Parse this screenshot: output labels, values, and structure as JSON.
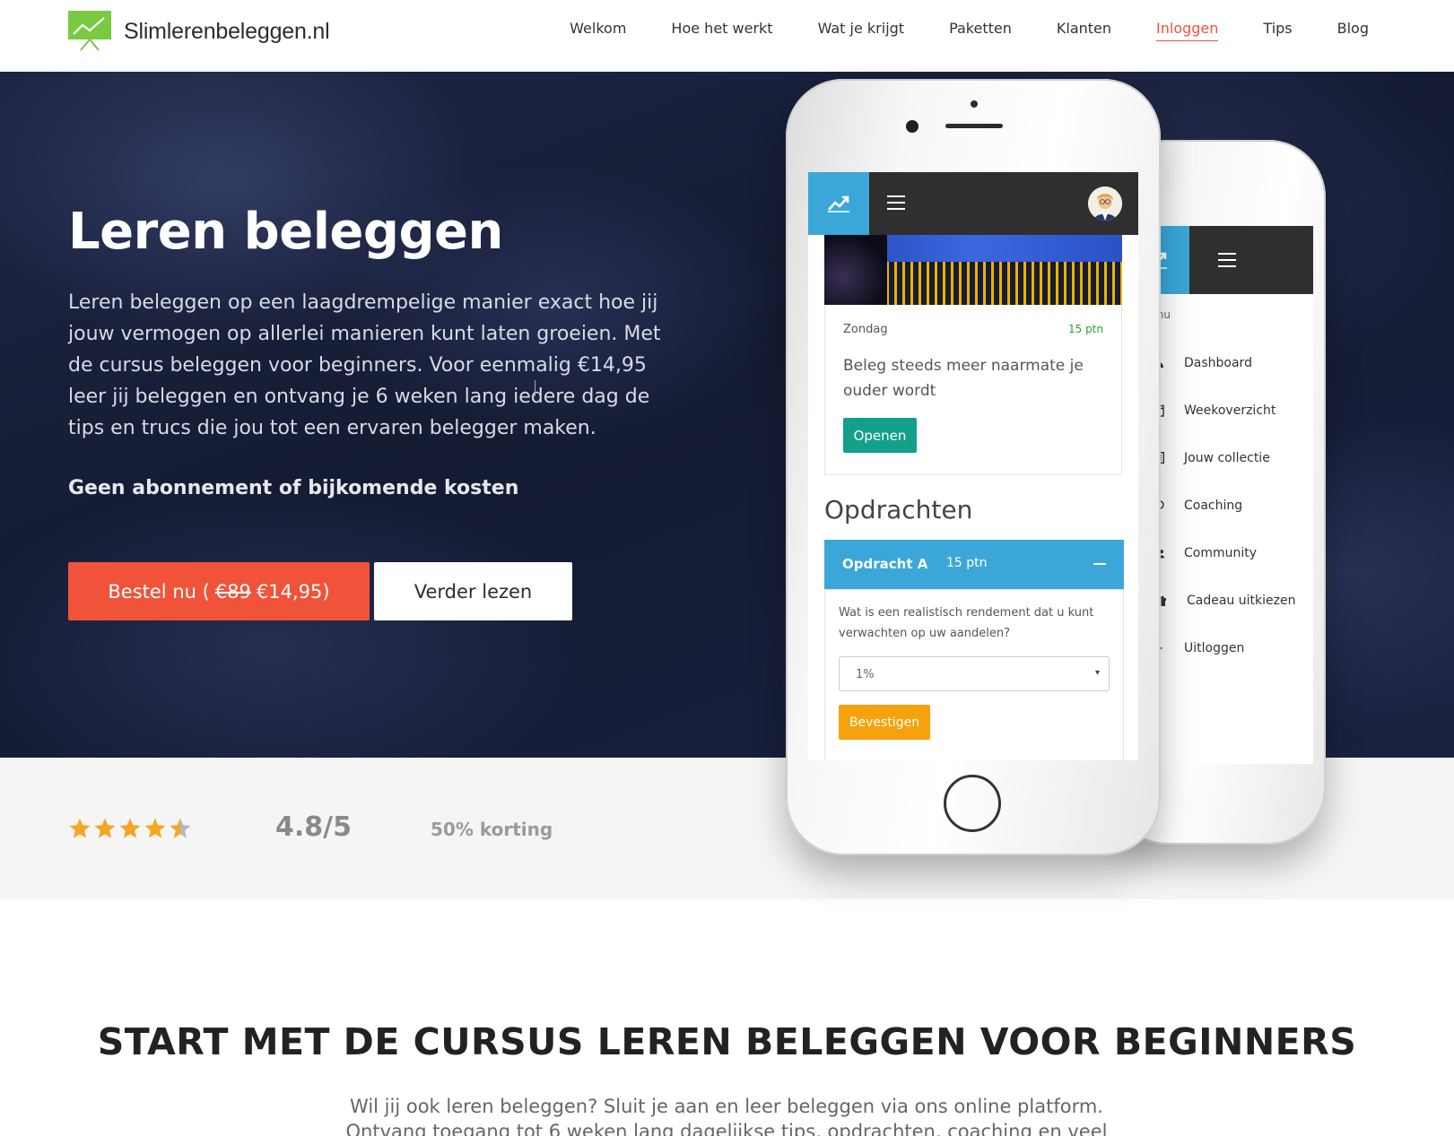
{
  "site": {
    "logo_text": "Slimlerenbeleggen.nl",
    "brand_color": "#7ac943",
    "accent_color": "#f0533a"
  },
  "nav": {
    "items": [
      {
        "label": "Welkom",
        "active": false
      },
      {
        "label": "Hoe het werkt",
        "active": false
      },
      {
        "label": "Wat je krijgt",
        "active": false
      },
      {
        "label": "Paketten",
        "active": false
      },
      {
        "label": "Klanten",
        "active": false
      },
      {
        "label": "Inloggen",
        "active": true
      },
      {
        "label": "Tips",
        "active": false
      },
      {
        "label": "Blog",
        "active": false
      }
    ]
  },
  "hero": {
    "title": "Leren beleggen",
    "description": "Leren beleggen op een laagdrempelige manier exact hoe jij jouw vermogen op allerlei manieren kunt laten groeien. Met de cursus beleggen voor beginners. Voor eenmalig €14,95 leer jij beleggen en ontvang je 6 weken lang iedere dag de tips en trucs die jou tot een ervaren belegger maken.",
    "note": "Geen abonnement of bijkomende kosten",
    "order_button": {
      "prefix": "Bestel nu (",
      "old_price": "€89",
      "new_price": "€14,95)"
    },
    "read_button": "Verder lezen"
  },
  "rating": {
    "stars": 4.5,
    "score": "4.8/5",
    "discount": "50% korting",
    "star_color": "#f5a623"
  },
  "phone_front": {
    "card": {
      "day": "Zondag",
      "points": "15 ptn",
      "text": "Beleg steeds meer naarmate je ouder wordt",
      "open_button": "Openen"
    },
    "section_title": "Opdrachten",
    "assignment": {
      "label": "Opdracht A",
      "points": "15 ptn",
      "question": "Wat is een realistisch rendement dat u kunt verwachten op uw aandelen?",
      "select_value": "1%",
      "confirm_button": "Bevestigen"
    }
  },
  "phone_back": {
    "menu_caption": "Menu",
    "menu_items": [
      {
        "icon": "dashboard-icon",
        "label": "Dashboard"
      },
      {
        "icon": "calendar-check-icon",
        "label": "Weekoverzicht"
      },
      {
        "icon": "list-icon",
        "label": "Jouw collectie"
      },
      {
        "icon": "chat-icon",
        "label": "Coaching"
      },
      {
        "icon": "users-icon",
        "label": "Community"
      },
      {
        "icon": "gift-icon",
        "label": "Cadeau uitkiezen"
      },
      {
        "icon": "logout-icon",
        "label": "Uitloggen"
      }
    ]
  },
  "lower": {
    "title": "START MET DE CURSUS LEREN BELEGGEN VOOR BEGINNERS",
    "text": "Wil jij ook leren beleggen? Sluit je aan en leer beleggen via ons online platform. Ontvang toegang tot 6 weken lang dagelijkse tips, opdrachten, coaching en veel"
  }
}
